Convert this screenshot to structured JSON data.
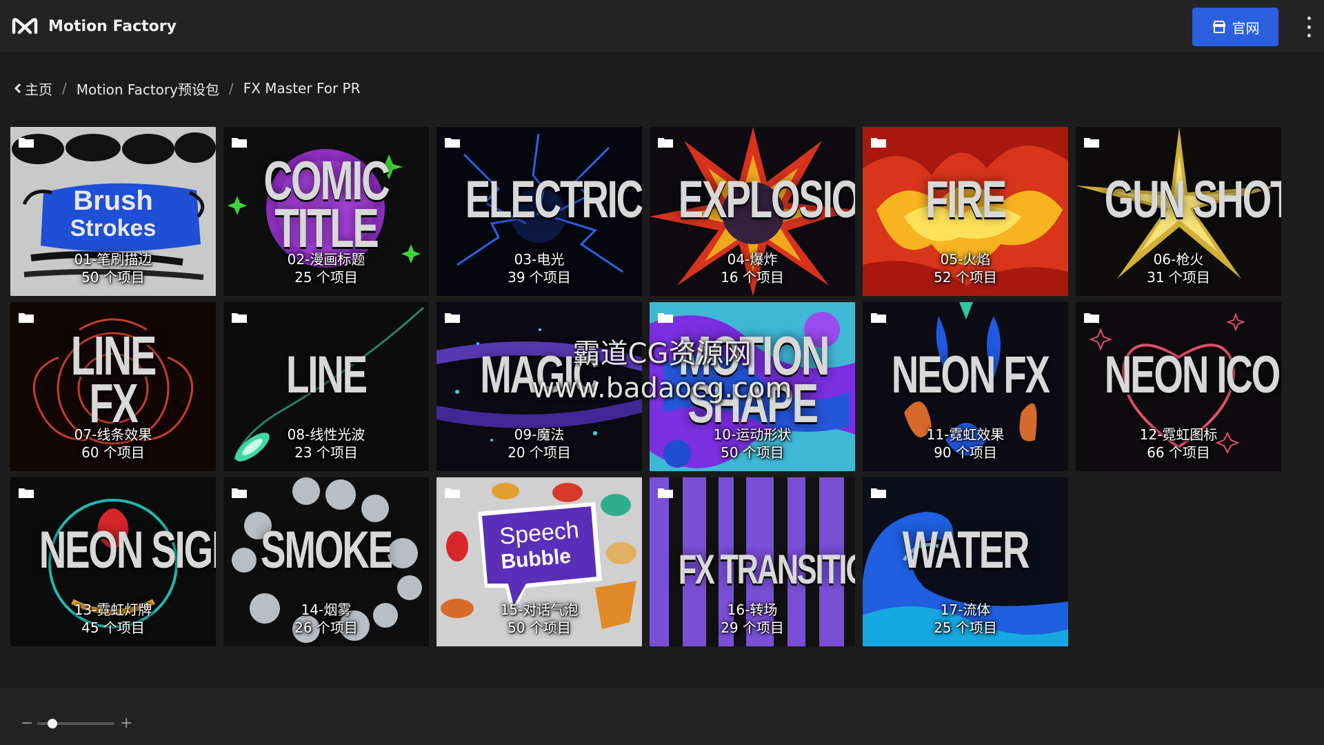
{
  "app": {
    "title": "Motion Factory",
    "brand_color": "#2b5fe0"
  },
  "header": {
    "site_button_label": "官网",
    "site_icon": "store-icon",
    "more_icon": "kebab-menu-icon"
  },
  "breadcrumb": {
    "items": [
      "主页",
      "Motion Factory预设包",
      "FX Master For PR"
    ],
    "separator": "/"
  },
  "folders": [
    {
      "art_text": "Brush\nStrokes",
      "name": "01-笔刷描边",
      "count": "50 个项目"
    },
    {
      "art_text": "COMIC\nTITLE",
      "name": "02-漫画标题",
      "count": "25 个项目"
    },
    {
      "art_text": "ELECTRIC",
      "name": "03-电光",
      "count": "39 个项目"
    },
    {
      "art_text": "EXPLOSION",
      "name": "04-爆炸",
      "count": "16 个项目"
    },
    {
      "art_text": "FIRE",
      "name": "05-火焰",
      "count": "52 个项目"
    },
    {
      "art_text": "GUN SHOT",
      "name": "06-枪火",
      "count": "31 个项目"
    },
    {
      "art_text": "LINE\nFX",
      "name": "07-线条效果",
      "count": "60 个项目"
    },
    {
      "art_text": "LINE",
      "name": "08-线性光波",
      "count": "23 个项目"
    },
    {
      "art_text": "MAGIC",
      "name": "09-魔法",
      "count": "20 个项目"
    },
    {
      "art_text": "MOTION\nSHAPE",
      "name": "10-运动形状",
      "count": "50 个项目"
    },
    {
      "art_text": "NEON FX",
      "name": "11-霓虹效果",
      "count": "90 个项目"
    },
    {
      "art_text": "NEON ICON",
      "name": "12-霓虹图标",
      "count": "66 个项目"
    },
    {
      "art_text": "NEON SIGN",
      "name": "13-霓虹灯牌",
      "count": "45 个项目"
    },
    {
      "art_text": "SMOKE",
      "name": "14-烟雾",
      "count": "26 个项目"
    },
    {
      "art_text": "Speech\nBubble",
      "name": "15-对话气泡",
      "count": "50 个项目"
    },
    {
      "art_text": "FX TRANSITION",
      "name": "16-转场",
      "count": "29 个项目"
    },
    {
      "art_text": "WATER",
      "name": "17-流体",
      "count": "25 个项目"
    }
  ],
  "watermark": {
    "line1": "霸道CG资源网",
    "line2": "www.badaocg.com"
  },
  "zoom": {
    "minus": "−",
    "plus": "+",
    "level": 0.2
  }
}
